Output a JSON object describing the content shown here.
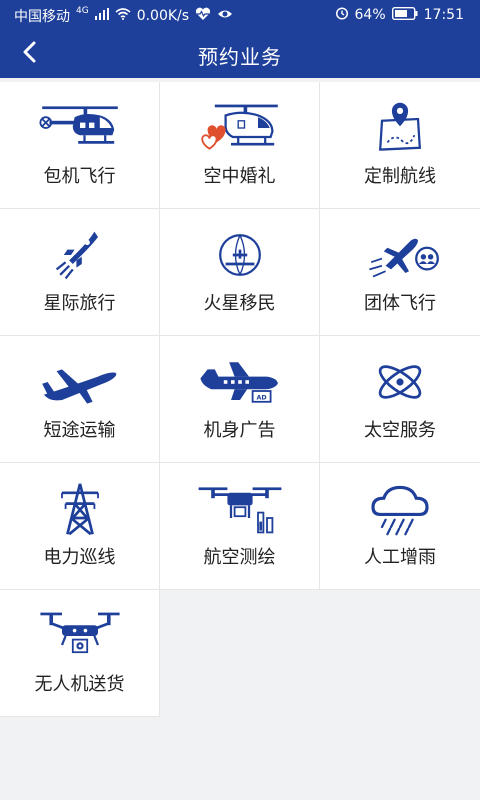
{
  "status": {
    "carrier": "中国移动",
    "network": "4G",
    "speed": "0.00K/s",
    "battery": "64%",
    "time": "17:51"
  },
  "header": {
    "title": "预约业务"
  },
  "services": [
    {
      "label": "包机飞行",
      "icon": "helicopter-icon"
    },
    {
      "label": "空中婚礼",
      "icon": "wedding-helicopter-icon"
    },
    {
      "label": "定制航线",
      "icon": "map-pin-route-icon"
    },
    {
      "label": "星际旅行",
      "icon": "rocket-icon"
    },
    {
      "label": "火星移民",
      "icon": "planet-plane-icon"
    },
    {
      "label": "团体飞行",
      "icon": "plane-group-icon"
    },
    {
      "label": "短途运输",
      "icon": "airplane-icon"
    },
    {
      "label": "机身广告",
      "icon": "airplane-ad-icon"
    },
    {
      "label": "太空服务",
      "icon": "atom-icon"
    },
    {
      "label": "电力巡线",
      "icon": "power-tower-icon"
    },
    {
      "label": "航空测绘",
      "icon": "drone-survey-icon"
    },
    {
      "label": "人工增雨",
      "icon": "rain-cloud-icon"
    },
    {
      "label": "无人机送货",
      "icon": "drone-delivery-icon"
    }
  ]
}
